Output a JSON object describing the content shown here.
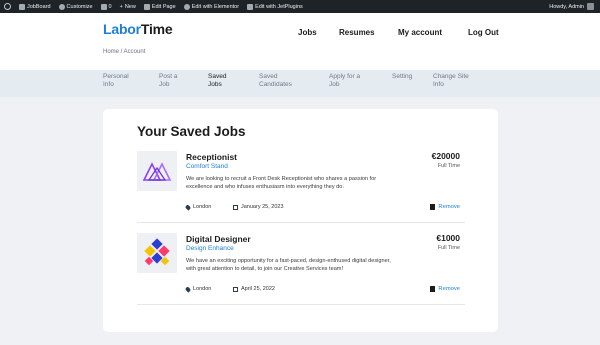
{
  "adminbar": {
    "items": [
      {
        "icon": "wordpress-icon",
        "label": ""
      },
      {
        "icon": "home-icon",
        "label": "JobBoard"
      },
      {
        "icon": "brush-icon",
        "label": "Customize"
      },
      {
        "icon": "comment-icon",
        "label": "0"
      },
      {
        "icon": "plus-icon",
        "label": "New"
      },
      {
        "icon": "edit-icon",
        "label": "Edit Page"
      },
      {
        "icon": "elementor-icon",
        "label": "Edit with Elementor"
      },
      {
        "icon": "jetplugins-icon",
        "label": "Edit with JetPlugins"
      }
    ],
    "greeting": "Howdy, Admin"
  },
  "header": {
    "logo_part1": "Labor",
    "logo_part2": "Time",
    "nav": [
      "Jobs",
      "Resumes",
      "My account",
      "Log Out"
    ],
    "breadcrumb": "Home / Account"
  },
  "subnav": [
    {
      "line1": "Personal",
      "line2": "Info",
      "active": false
    },
    {
      "line1": "Post a",
      "line2": "Job",
      "active": false
    },
    {
      "line1": "Saved",
      "line2": "Jobs",
      "active": true
    },
    {
      "line1": "Saved",
      "line2": "Candidates",
      "active": false
    },
    {
      "line1": "Apply for a",
      "line2": "Job",
      "active": false
    },
    {
      "line1": "Setting",
      "line2": "",
      "active": false
    },
    {
      "line1": "Change Site",
      "line2": "Info",
      "active": false
    }
  ],
  "main": {
    "title": "Your Saved Jobs",
    "remove_label": "Remove",
    "jobs": [
      {
        "title": "Receptionist",
        "company": "Comfort Stand",
        "description": "We are looking to recruit a Front Desk Receptionist who shares a passion for excellence and who infuses enthusiasm into everything they do.",
        "salary": "€20000",
        "type": "Full Time",
        "location": "London",
        "date": "January 25, 2023",
        "logo_color": "#8a3ffc"
      },
      {
        "title": "Digital Designer",
        "company": "Design Enhance",
        "description": "We have an exciting opportunity for a fast-paced, design-enthused digital designer, with great attention to detail, to join our Creative Services team!",
        "salary": "€1000",
        "type": "Full Time",
        "location": "London",
        "date": "April 25, 2022",
        "logo_color": "#2b3fd6"
      }
    ]
  },
  "colors": {
    "accent": "#1f7fd6",
    "adminbar": "#1d2327",
    "subnav_bg": "#e4ebf1",
    "page_bg": "#f0f1f4"
  }
}
